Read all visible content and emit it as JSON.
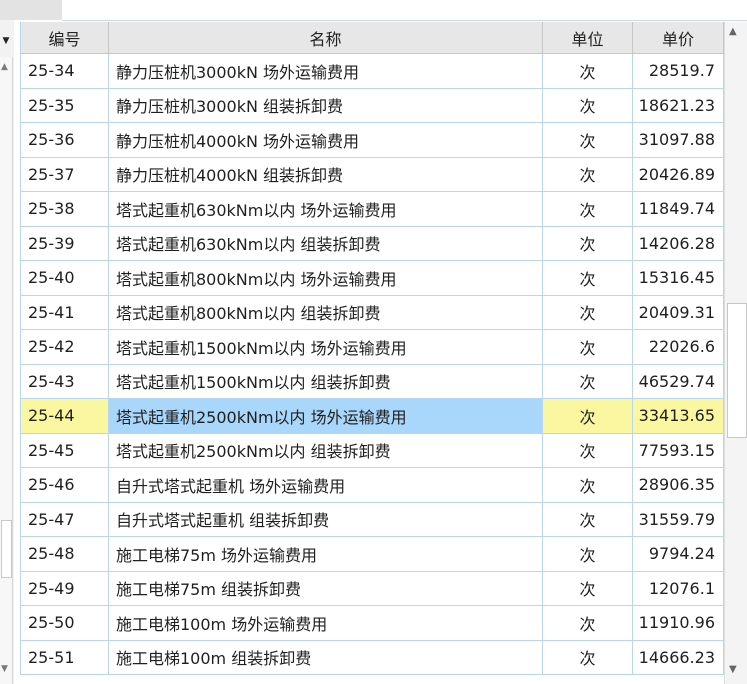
{
  "table": {
    "columns": [
      "编号",
      "名称",
      "单位",
      "单价"
    ],
    "rows": [
      {
        "code": "25-34",
        "name": "静力压桩机3000kN 场外运输费用",
        "unit": "次",
        "price": "28519.7"
      },
      {
        "code": "25-35",
        "name": "静力压桩机3000kN 组装拆卸费",
        "unit": "次",
        "price": "18621.23"
      },
      {
        "code": "25-36",
        "name": "静力压桩机4000kN 场外运输费用",
        "unit": "次",
        "price": "31097.88"
      },
      {
        "code": "25-37",
        "name": "静力压桩机4000kN 组装拆卸费",
        "unit": "次",
        "price": "20426.89"
      },
      {
        "code": "25-38",
        "name": "塔式起重机630kNm以内 场外运输费用",
        "unit": "次",
        "price": "11849.74"
      },
      {
        "code": "25-39",
        "name": "塔式起重机630kNm以内 组装拆卸费",
        "unit": "次",
        "price": "14206.28"
      },
      {
        "code": "25-40",
        "name": "塔式起重机800kNm以内 场外运输费用",
        "unit": "次",
        "price": "15316.45"
      },
      {
        "code": "25-41",
        "name": "塔式起重机800kNm以内 组装拆卸费",
        "unit": "次",
        "price": "20409.31"
      },
      {
        "code": "25-42",
        "name": "塔式起重机1500kNm以内 场外运输费用",
        "unit": "次",
        "price": "22026.6"
      },
      {
        "code": "25-43",
        "name": "塔式起重机1500kNm以内 组装拆卸费",
        "unit": "次",
        "price": "46529.74"
      },
      {
        "code": "25-44",
        "name": "塔式起重机2500kNm以内 场外运输费用",
        "unit": "次",
        "price": "33413.65"
      },
      {
        "code": "25-45",
        "name": "塔式起重机2500kNm以内 组装拆卸费",
        "unit": "次",
        "price": "77593.15"
      },
      {
        "code": "25-46",
        "name": "自升式塔式起重机 场外运输费用",
        "unit": "次",
        "price": "28906.35"
      },
      {
        "code": "25-47",
        "name": "自升式塔式起重机 组装拆卸费",
        "unit": "次",
        "price": "31559.79"
      },
      {
        "code": "25-48",
        "name": "施工电梯75m 场外运输费用",
        "unit": "次",
        "price": "9794.24"
      },
      {
        "code": "25-49",
        "name": "施工电梯75m 组装拆卸费",
        "unit": "次",
        "price": "12076.1"
      },
      {
        "code": "25-50",
        "name": "施工电梯100m 场外运输费用",
        "unit": "次",
        "price": "11910.96"
      },
      {
        "code": "25-51",
        "name": "施工电梯100m 组装拆卸费",
        "unit": "次",
        "price": "14666.23"
      }
    ],
    "selected_row_index": 10
  },
  "icons": {
    "dropdown": "caret-down-icon",
    "scroll_up": "scroll-up-arrow-icon",
    "scroll_down": "scroll-down-arrow-icon"
  },
  "colors": {
    "selected_name_cell": "#a9d6fb",
    "selected_other_cells": "#fbf7a0",
    "grid_line": "#b8d6f0",
    "header_bg": "#e7e7e7"
  }
}
